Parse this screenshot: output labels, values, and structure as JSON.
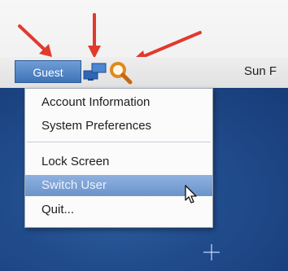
{
  "menubar": {
    "user_menu_label": "Guest",
    "app_text": "Sun F"
  },
  "dropdown": {
    "items": [
      {
        "label": "Account Information"
      },
      {
        "label": "System Preferences"
      },
      {
        "label": "Lock Screen"
      },
      {
        "label": "Switch User",
        "highlighted": true
      },
      {
        "label": "Quit..."
      }
    ]
  },
  "icons": {
    "network": "network-icon",
    "search": "magnifier-icon",
    "pointer": "mouse-pointer-icon",
    "annotation_arrow": "red-arrow-icon"
  },
  "colors": {
    "highlight": "#7aa1d6",
    "annotation": "#e23a2e",
    "desktop": "#214c8c",
    "search_icon": "#e08a1c"
  }
}
